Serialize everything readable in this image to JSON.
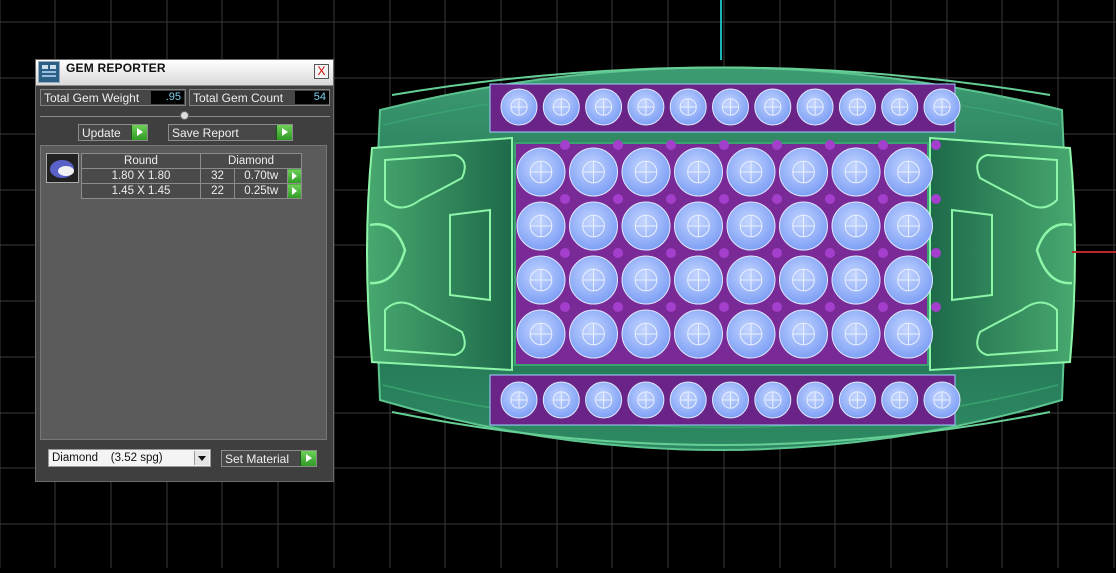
{
  "panel": {
    "title": "GEM REPORTER",
    "close_glyph": "X",
    "total_weight_label": "Total Gem Weight",
    "total_weight_value": ".95",
    "total_count_label": "Total Gem Count",
    "total_count_value": "54",
    "update_label": "Update",
    "save_report_label": "Save Report",
    "table": {
      "headers": [
        "Round",
        "Diamond"
      ],
      "rows": [
        {
          "size": "1.80 X 1.80",
          "count": "32",
          "weight": "0.70tw"
        },
        {
          "size": "1.45 X 1.45",
          "count": "22",
          "weight": "0.25tw"
        }
      ]
    },
    "material_select": "Diamond    (3.52 spg)",
    "set_material_label": "Set Material"
  },
  "icons": {
    "title": "gem-reporter-app-icon",
    "thumbnail": "gem-thumbnail-icon",
    "arrows": "play-arrow-icon"
  },
  "colors": {
    "background": "#000000",
    "grid": "#3a3a3a",
    "ring_green": "#2f8a62",
    "gem_blue": "#8fb1ff",
    "setting_purple": "#7a2a96",
    "button_green": "#3fb42f",
    "value_cyan": "#7ad2f0"
  }
}
